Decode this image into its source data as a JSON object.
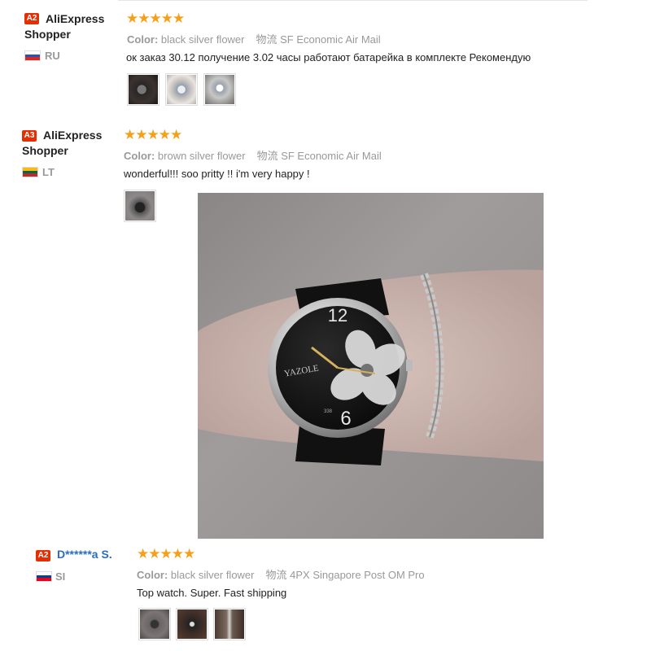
{
  "reviews": [
    {
      "badge": "A2",
      "user_line1": "AliExpress",
      "user_line2": "Shopper",
      "country_code": "RU",
      "stars": "★★★★★",
      "color_label": "Color:",
      "color_value": "black silver flower",
      "shipping_label": "物流",
      "shipping_value": "SF Economic Air Mail",
      "text": "ок заказ 30.12 получение 3.02 часы работают батарейка в комплекте Рекомендую",
      "thumbnails": [
        "photo-thumb-1",
        "photo-thumb-2",
        "photo-thumb-3"
      ]
    },
    {
      "badge": "A3",
      "user_line1": "AliExpress",
      "user_line2": "Shopper",
      "country_code": "LT",
      "stars": "★★★★★",
      "color_label": "Color:",
      "color_value": "brown silver flower",
      "shipping_label": "物流",
      "shipping_value": "SF Economic Air Mail",
      "text": "wonderful!!! soo pritty !! i'm very happy !",
      "thumbnails": [
        "photo-thumb-1"
      ],
      "expanded_photo": {
        "watch_brand": "YAZOLE",
        "dial_12": "12",
        "dial_6": "6",
        "model": "338"
      }
    },
    {
      "badge": "A2",
      "user_name": "D******a S.",
      "country_code": "SI",
      "stars": "★★★★★",
      "color_label": "Color:",
      "color_value": "black silver flower",
      "shipping_label": "物流",
      "shipping_value": "4PX Singapore Post OM Pro",
      "text": "Top watch. Super. Fast shipping",
      "thumbnails": [
        "photo-thumb-1",
        "photo-thumb-2",
        "photo-thumb-3"
      ]
    }
  ],
  "colors": {
    "badge": "#e62e04",
    "star": "#f6a01a",
    "link": "#2a6ebb",
    "meta": "#999999"
  }
}
